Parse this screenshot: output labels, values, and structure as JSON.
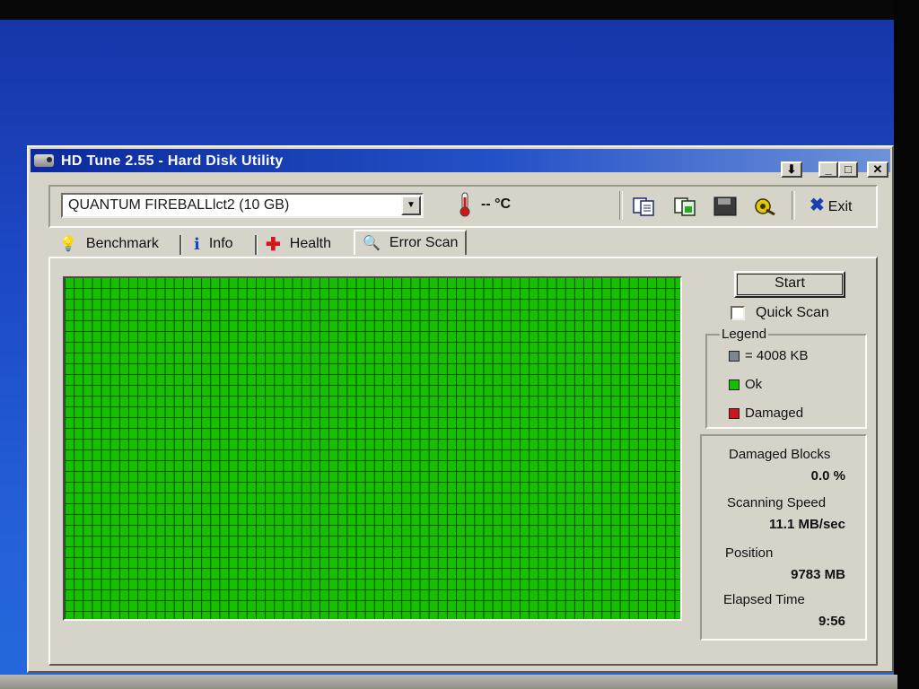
{
  "window": {
    "title": "HD Tune 2.55 - Hard Disk Utility",
    "controls": {
      "pin": "⬇",
      "minimize": "_",
      "maximize": "□",
      "close": "✕"
    }
  },
  "toolbar": {
    "drive": "QUANTUM FIREBALLlct2 (10 GB)",
    "temperature": "-- °C",
    "exit_label": "Exit",
    "icons": [
      "copy-text-icon",
      "copy-screenshot-icon",
      "save-icon",
      "options-icon"
    ]
  },
  "tabs": [
    {
      "label": "Benchmark",
      "icon": "bulb-icon"
    },
    {
      "label": "Info",
      "icon": "info-icon"
    },
    {
      "label": "Health",
      "icon": "health-cross-icon"
    },
    {
      "label": "Error Scan",
      "icon": "magnifier-icon",
      "active": true
    }
  ],
  "scan": {
    "start_label": "Start",
    "quick_scan_label": "Quick Scan",
    "quick_scan_checked": false,
    "block_state": "ok",
    "colors": {
      "ok": "#16c000",
      "damaged": "#d0141c",
      "block": "#7b8594"
    }
  },
  "legend": {
    "title": "Legend",
    "block_size": "= 4008 KB",
    "ok": "Ok",
    "damaged": "Damaged"
  },
  "stats": {
    "damaged_blocks_label": "Damaged Blocks",
    "damaged_blocks_value": "0.0 %",
    "speed_label": "Scanning Speed",
    "speed_value": "11.1 MB/sec",
    "position_label": "Position",
    "position_value": "9783 MB",
    "elapsed_label": "Elapsed Time",
    "elapsed_value": "9:56"
  }
}
